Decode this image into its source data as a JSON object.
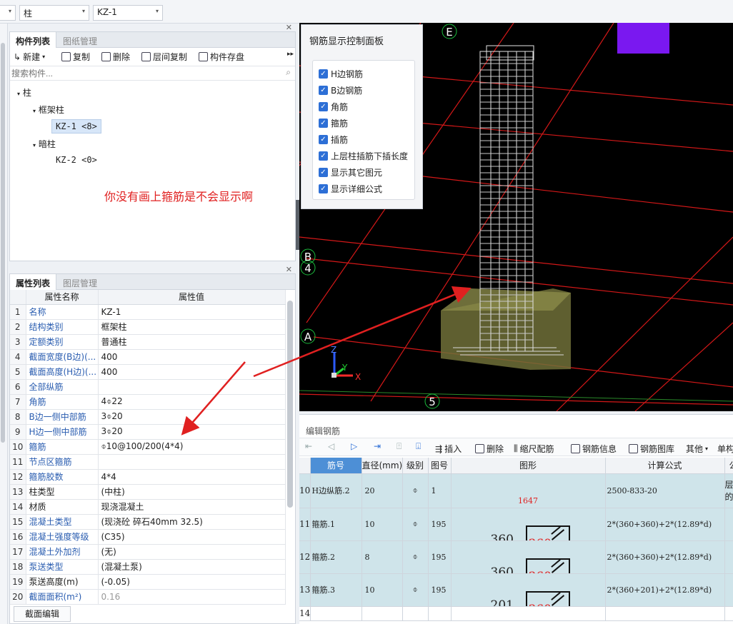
{
  "topbar": {
    "combo1_value": "柱",
    "combo2_value": "KZ-1"
  },
  "comp_panel": {
    "tab_active": "构件列表",
    "tab_other": "图纸管理",
    "tools": [
      "新建",
      "复制",
      "删除",
      "层间复制",
      "构件存盘"
    ],
    "search_placeholder": "搜索构件...",
    "tree": {
      "root": "柱",
      "group1": "框架柱",
      "item1": "KZ-1 <8>",
      "group2": "暗柱",
      "item2": "KZ-2 <0>"
    }
  },
  "annotation": "你没有画上箍筋是不会显示啊",
  "prop_panel": {
    "tab_active": "属性列表",
    "tab_other": "图层管理",
    "col_name": "属性名称",
    "col_value": "属性值",
    "rows": [
      {
        "n": "1",
        "name": "名称",
        "value": "KZ-1"
      },
      {
        "n": "2",
        "name": "结构类别",
        "value": "框架柱"
      },
      {
        "n": "3",
        "name": "定额类别",
        "value": "普通柱"
      },
      {
        "n": "4",
        "name": "截面宽度(B边)(...",
        "value": "400"
      },
      {
        "n": "5",
        "name": "截面高度(H边)(...",
        "value": "400"
      },
      {
        "n": "6",
        "name": "全部纵筋",
        "value": ""
      },
      {
        "n": "7",
        "name": "角筋",
        "value": "4⌽22"
      },
      {
        "n": "8",
        "name": "B边一侧中部筋",
        "value": "3⌽20"
      },
      {
        "n": "9",
        "name": "H边一侧中部筋",
        "value": "3⌽20"
      },
      {
        "n": "10",
        "name": "箍筋",
        "value": "⌽10@100/200(4*4)"
      },
      {
        "n": "11",
        "name": "节点区箍筋",
        "value": ""
      },
      {
        "n": "12",
        "name": "箍筋胶数",
        "value": "4*4"
      },
      {
        "n": "13",
        "name": "柱类型",
        "value": "(中柱)"
      },
      {
        "n": "14",
        "name": "材质",
        "value": "现浇混凝土"
      },
      {
        "n": "15",
        "name": "混凝土类型",
        "value": "(现浇砼 碎石40mm 32.5)"
      },
      {
        "n": "16",
        "name": "混凝土强度等级",
        "value": "(C35)"
      },
      {
        "n": "17",
        "name": "混凝土外加剂",
        "value": "(无)"
      },
      {
        "n": "18",
        "name": "泵送类型",
        "value": "(混凝土泵)"
      },
      {
        "n": "19",
        "name": "泵送高度(m)",
        "value": "(-0.05)"
      },
      {
        "n": "20",
        "name": "截面面积(m²)",
        "value": "0.16"
      }
    ],
    "section_edit_button": "截面编辑"
  },
  "control_panel": {
    "title": "钢筋显示控制面板",
    "items": [
      "H边钢筋",
      "B边钢筋",
      "角筋",
      "箍筋",
      "插筋",
      "上层柱插筋下插长度",
      "显示其它图元",
      "显示详细公式"
    ]
  },
  "view3d": {
    "axis_labels": {
      "E": "E",
      "B": "B",
      "n4": "4",
      "A": "A",
      "n5": "5"
    },
    "axis_z": "Z",
    "axis_y": "Y",
    "axis_x": "X"
  },
  "edit_panel": {
    "title": "编辑钢筋",
    "tools": [
      "插入",
      "删除",
      "缩尺配筋",
      "钢筋信息",
      "钢筋图库",
      "其他",
      "单构"
    ],
    "columns": [
      "筋号",
      "直径(mm)",
      "级别",
      "图号",
      "图形",
      "计算公式",
      "公"
    ],
    "rows": [
      {
        "n": "10",
        "name": "H边纵筋.2",
        "dia": "20",
        "grade": "⌽",
        "fig": "1",
        "shape_len": "1647",
        "shape_a": "",
        "shape_b": "",
        "formula": "2500-833-20",
        "extra": "层\n的"
      },
      {
        "n": "11",
        "name": "箍筋.1",
        "dia": "10",
        "grade": "⌽",
        "fig": "195",
        "shape_len": "",
        "shape_a": "360",
        "shape_b": "360",
        "formula": "2*(360+360)+2*(12.89*d)",
        "extra": ""
      },
      {
        "n": "12",
        "name": "箍筋.2",
        "dia": "8",
        "grade": "⌽",
        "fig": "195",
        "shape_len": "",
        "shape_a": "360",
        "shape_b": "360",
        "formula": "2*(360+360)+2*(12.89*d)",
        "extra": ""
      },
      {
        "n": "13",
        "name": "箍筋.3",
        "dia": "10",
        "grade": "⌽",
        "fig": "195",
        "shape_len": "",
        "shape_a": "201",
        "shape_b": "360",
        "formula": "2*(360+201)+2*(12.89*d)",
        "extra": ""
      },
      {
        "n": "14",
        "name": "",
        "dia": "",
        "grade": "",
        "fig": "",
        "shape_len": "",
        "shape_a": "",
        "shape_b": "",
        "formula": "",
        "extra": ""
      }
    ]
  },
  "colors": {
    "accent": "#2d6fd6",
    "annotation": "#e02020",
    "purple_block": "#7a18f0",
    "grid_red": "#d41818",
    "footing": "#707038"
  }
}
